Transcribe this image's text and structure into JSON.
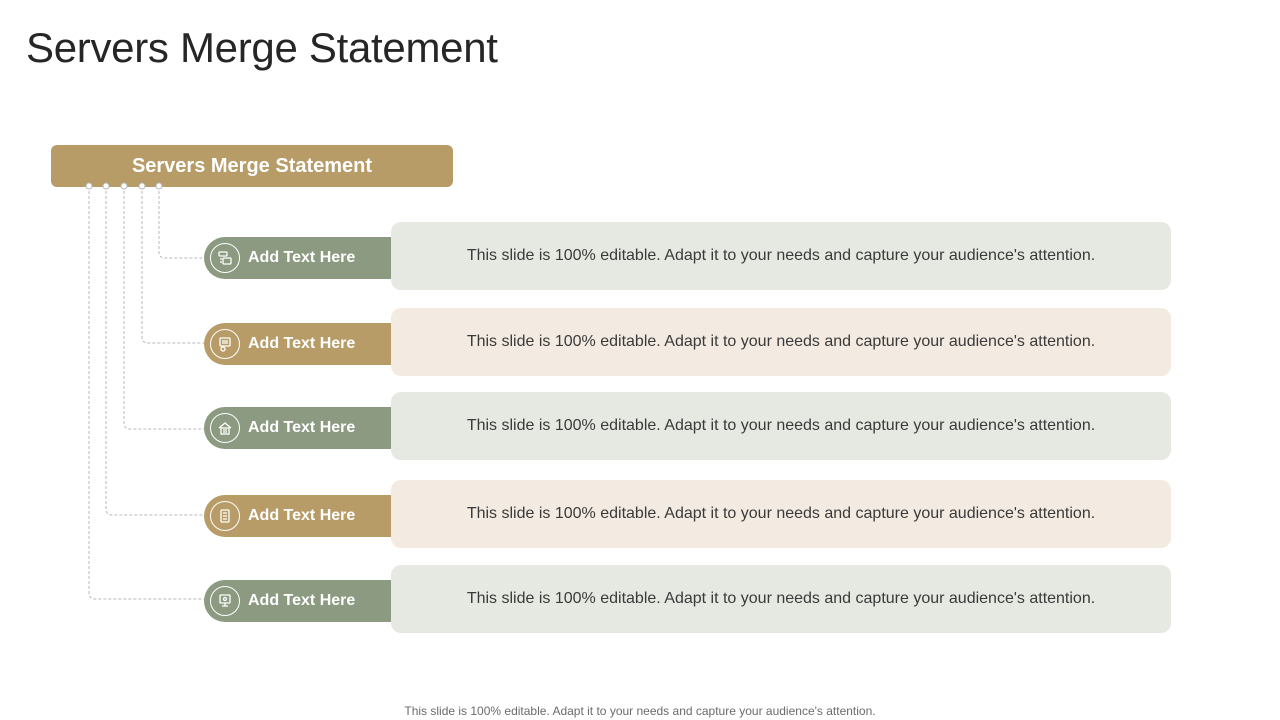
{
  "title": "Servers Merge Statement",
  "header_box_label": "Servers Merge Statement",
  "rows": [
    {
      "label": "Add Text Here",
      "text": "This slide is 100% editable. Adapt it to your needs and capture your audience's attention.",
      "icon": "server-stack-icon",
      "color": "#8b9a80"
    },
    {
      "label": "Add Text Here",
      "text": "This slide is 100% editable. Adapt it to your needs and capture your audience's attention.",
      "icon": "database-gear-icon",
      "color": "#b89c68"
    },
    {
      "label": "Add Text Here",
      "text": "This slide is 100% editable. Adapt it to your needs and capture your audience's attention.",
      "icon": "data-center-icon",
      "color": "#8b9a80"
    },
    {
      "label": "Add Text Here",
      "text": "This slide is 100% editable. Adapt it to your needs and capture your audience's attention.",
      "icon": "server-rack-icon",
      "color": "#b89c68"
    },
    {
      "label": "Add Text Here",
      "text": "This slide is 100% editable. Adapt it to your needs and capture your audience's attention.",
      "icon": "server-monitor-icon",
      "color": "#8b9a80"
    }
  ],
  "footer": "This slide is 100% editable. Adapt it to your needs and capture your audience's attention."
}
